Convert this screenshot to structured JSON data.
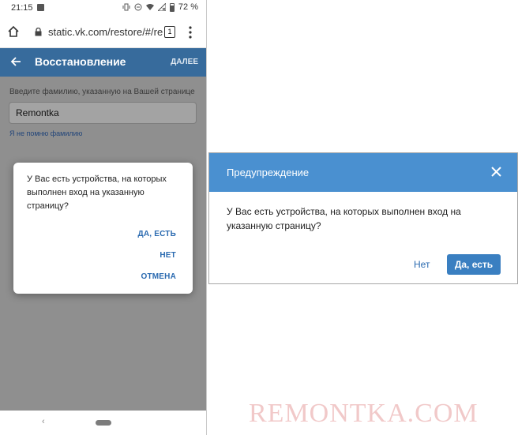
{
  "status_bar": {
    "time": "21:15",
    "battery": "72 %"
  },
  "browser": {
    "url": "static.vk.com/restore/#/re",
    "tab_count": "1"
  },
  "app_bar": {
    "title": "Восстановление",
    "next_label": "ДАЛЕЕ"
  },
  "form": {
    "label": "Введите фамилию, указанную на Вашей странице",
    "value": "Remontka",
    "forgot_link": "Я не помню фамилию"
  },
  "mobile_dialog": {
    "message": "У Вас есть устройства, на которых выполнен вход на указанную страницу?",
    "yes": "ДА, ЕСТЬ",
    "no": "НЕТ",
    "cancel": "ОТМЕНА"
  },
  "desktop_dialog": {
    "title": "Предупреждение",
    "message": "У Вас есть устройства, на которых выполнен вход на указанную страницу?",
    "no": "Нет",
    "yes": "Да, есть"
  },
  "watermark": "REMONTKA.COM",
  "colors": {
    "app_bar": "#376b9c",
    "dialog_header": "#4a90d0",
    "primary_button": "#3a7fc1",
    "link": "#2a6ab0"
  }
}
